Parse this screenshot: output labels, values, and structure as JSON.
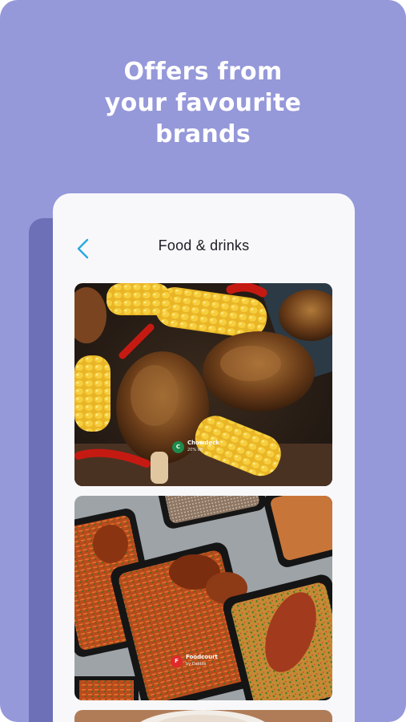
{
  "headline": {
    "line1": "Offers from",
    "line2": "your favourite",
    "line3": "brands"
  },
  "screen": {
    "title": "Food & drinks"
  },
  "offers": [
    {
      "brand": "Chowdeck",
      "sub": "20% off"
    },
    {
      "brand": "Foodcourt",
      "sub": "by Dabble"
    }
  ],
  "colors": {
    "background": "#9598d9",
    "accent_back": "#29a8e0",
    "card_bg": "#f8f8fb"
  },
  "icons": {
    "back": "chevron-left-icon"
  }
}
